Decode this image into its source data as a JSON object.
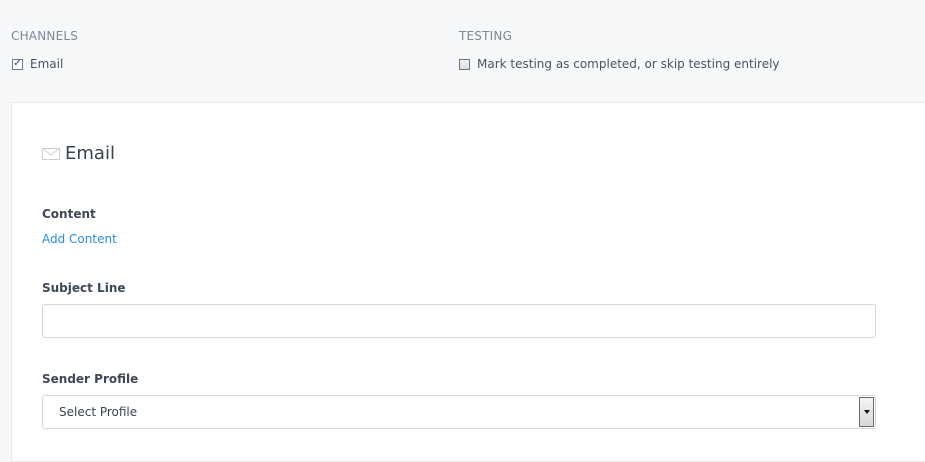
{
  "channels": {
    "label": "CHANNELS",
    "email_checkbox": {
      "label": "Email",
      "checked": true
    }
  },
  "testing": {
    "label": "TESTING",
    "skip_checkbox": {
      "label": "Mark testing as completed, or skip testing entirely",
      "checked": false
    }
  },
  "email_panel": {
    "title": "Email",
    "icon": "envelope-icon",
    "content": {
      "label": "Content",
      "add_link": "Add Content"
    },
    "subject": {
      "label": "Subject Line",
      "value": "",
      "placeholder": ""
    },
    "sender": {
      "label": "Sender Profile",
      "selected": "Select Profile"
    }
  },
  "colors": {
    "background": "#f7f8fa",
    "panel": "#ffffff",
    "link": "#2a8fd6",
    "section_label": "#7e8794"
  }
}
